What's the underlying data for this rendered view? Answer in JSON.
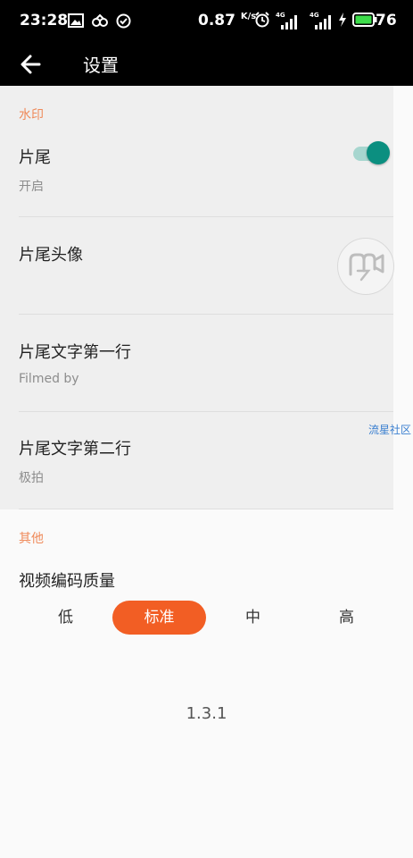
{
  "status_bar": {
    "time": "23:28",
    "net_speed": "0.87",
    "net_speed_unit": "K/s",
    "battery": "76",
    "signal_label_1": "4G",
    "signal_label_2": "4G",
    "icons": [
      "image-icon",
      "link-icon",
      "check-circle-icon",
      "alarm-icon",
      "signal-icon",
      "charging-icon",
      "battery-icon"
    ]
  },
  "appbar": {
    "title": "设置"
  },
  "watermark_section": {
    "header": "水印",
    "items": [
      {
        "title": "片尾",
        "subtitle": "开启"
      },
      {
        "title": "片尾头像"
      },
      {
        "title": "片尾文字第一行",
        "subtitle": "Filmed by"
      },
      {
        "title": "片尾文字第二行",
        "subtitle": "极拍"
      }
    ],
    "toggle_on": true
  },
  "floating_tag": "流星社区",
  "other_section": {
    "header": "其他",
    "quality_title": "视频编码质量",
    "quality_options": [
      "低",
      "标准",
      "中",
      "高"
    ],
    "quality_selected": "标准"
  },
  "version": "1.3.1",
  "colors": {
    "accent": "#f25e24",
    "section_header": "#ef8a5a",
    "toggle": "#0b8f80"
  }
}
